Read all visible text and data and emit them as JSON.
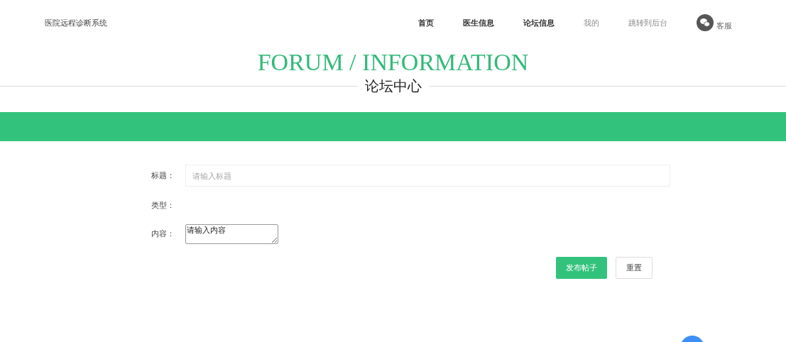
{
  "header": {
    "site_title": "医院远程诊断系统",
    "nav": [
      {
        "label": "首页",
        "bold": true
      },
      {
        "label": "医生信息",
        "bold": true
      },
      {
        "label": "论坛信息",
        "bold": true
      },
      {
        "label": "我的",
        "bold": false
      },
      {
        "label": "跳转到后台",
        "bold": false
      }
    ],
    "support": {
      "label": "客服"
    }
  },
  "banner": {
    "title": "FORUM / INFORMATION",
    "subtitle": "论坛中心"
  },
  "form": {
    "fields": [
      {
        "kind": "input",
        "label": "标题：",
        "placeholder": "请输入标题"
      },
      {
        "kind": "none",
        "label": "类型："
      },
      {
        "kind": "textarea",
        "label": "内容：",
        "value": "请输入内容"
      }
    ],
    "buttons": [
      {
        "label": "发布帖子",
        "primary": true
      },
      {
        "label": "重置",
        "primary": false
      }
    ]
  }
}
